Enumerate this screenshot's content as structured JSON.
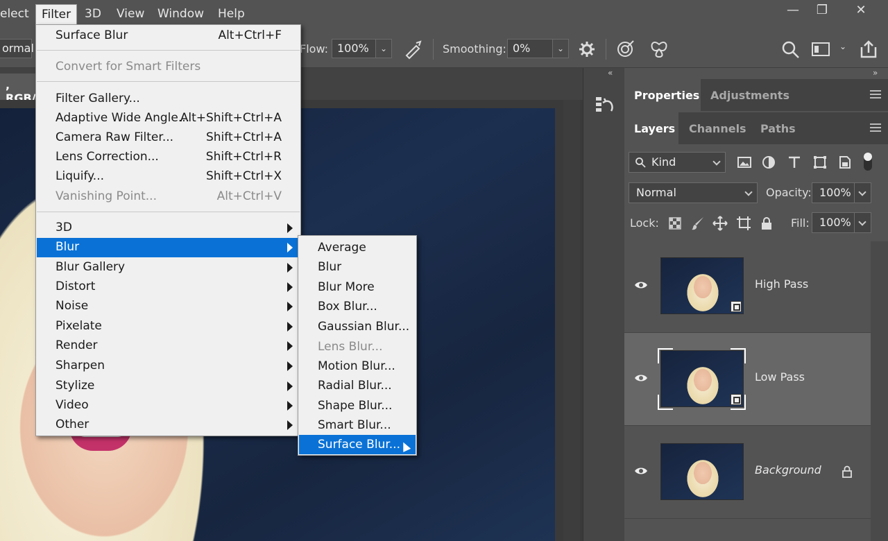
{
  "menubar": {
    "items": [
      "elect",
      "Filter",
      "3D",
      "View",
      "Window",
      "Help"
    ],
    "minimize": "—",
    "restore": "❐",
    "close": "✕"
  },
  "options": {
    "mode_value": "ormal",
    "flow_label": "Flow:",
    "flow_value": "100%",
    "smoothing_label": "Smoothing:",
    "smoothing_value": "0%"
  },
  "document": {
    "tab_label": ", RGB/"
  },
  "filter_menu": {
    "items": [
      {
        "label": "Surface Blur",
        "shortcut": "Alt+Ctrl+F"
      },
      {
        "label": "Convert for Smart Filters"
      },
      {
        "label": "Filter Gallery..."
      },
      {
        "label": "Adaptive Wide Angle...",
        "shortcut": "Alt+Shift+Ctrl+A"
      },
      {
        "label": "Camera Raw Filter...",
        "shortcut": "Shift+Ctrl+A"
      },
      {
        "label": "Lens Correction...",
        "shortcut": "Shift+Ctrl+R"
      },
      {
        "label": "Liquify...",
        "shortcut": "Shift+Ctrl+X"
      },
      {
        "label": "Vanishing Point...",
        "shortcut": "Alt+Ctrl+V"
      },
      {
        "label": "3D"
      },
      {
        "label": "Blur"
      },
      {
        "label": "Blur Gallery"
      },
      {
        "label": "Distort"
      },
      {
        "label": "Noise"
      },
      {
        "label": "Pixelate"
      },
      {
        "label": "Render"
      },
      {
        "label": "Sharpen"
      },
      {
        "label": "Stylize"
      },
      {
        "label": "Video"
      },
      {
        "label": "Other"
      }
    ]
  },
  "blur_menu": {
    "items": [
      "Average",
      "Blur",
      "Blur More",
      "Box Blur...",
      "Gaussian Blur...",
      "Lens Blur...",
      "Motion Blur...",
      "Radial Blur...",
      "Shape Blur...",
      "Smart Blur...",
      "Surface Blur..."
    ]
  },
  "panels": {
    "collapse_left": "«",
    "collapse_right": "»",
    "top_tabs": [
      "Properties",
      "Adjustments"
    ],
    "layer_tabs": [
      "Layers",
      "Channels",
      "Paths"
    ],
    "kind_label": "Kind",
    "blend_mode": "Normal",
    "opacity_label": "Opacity:",
    "opacity_value": "100%",
    "lock_label": "Lock:",
    "fill_label": "Fill:",
    "fill_value": "100%"
  },
  "layers": [
    {
      "name": "High Pass"
    },
    {
      "name": "Low Pass"
    },
    {
      "name": "Background"
    }
  ]
}
